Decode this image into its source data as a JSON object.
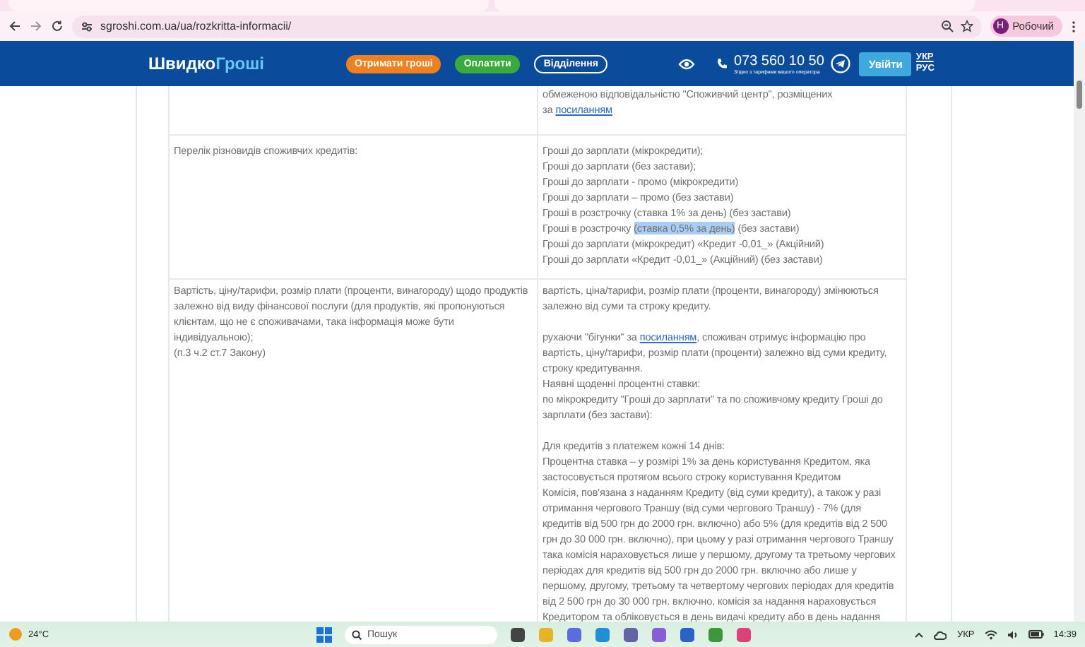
{
  "browser": {
    "url": "sgroshi.com.ua/ua/rozkritta-informacii/",
    "profile_initial": "Н",
    "profile_name": "Робочий"
  },
  "header": {
    "logo": {
      "part_1": "Швидко",
      "part_2": "Гроші"
    },
    "buttons": [
      {
        "label": "Отримати гроші",
        "kind": "orange"
      },
      {
        "label": "Оплатити",
        "kind": "green"
      },
      {
        "label": "Відділення",
        "kind": "outline"
      }
    ],
    "phone": "073 560 10 50",
    "phone_note": "Згідно з тарифами вашого оператора",
    "login": "Увійти",
    "languages": [
      {
        "label": "УКР",
        "selected": true
      },
      {
        "label": "РУС",
        "selected": false
      }
    ]
  },
  "table": {
    "rows": [
      {
        "label": [],
        "content": [
          {
            "kind": "text",
            "text": "обмеженою відповідальністю \"Споживчий центр\", розміщених"
          },
          {
            "kind": "link_text",
            "before": "за ",
            "link": "посиланням"
          }
        ]
      },
      {
        "label": [
          "Перелік різновидів споживчих кредитів:"
        ],
        "content": [
          {
            "kind": "list",
            "items": [
              {
                "segments": [
                  {
                    "text": "Гроші до зарплати (мікрокредити);",
                    "selected": false
                  }
                ]
              },
              {
                "segments": [
                  {
                    "text": "Гроші до зарплати (без застави);",
                    "selected": false
                  }
                ]
              },
              {
                "segments": [
                  {
                    "text": "Гроші до зарплати - промо (мікрокредити)",
                    "selected": false
                  }
                ]
              },
              {
                "segments": [
                  {
                    "text": "Гроші до зарплати – промо (без застави)",
                    "selected": false
                  }
                ]
              },
              {
                "segments": [
                  {
                    "text": "Гроші в розстрочку (ставка 1% за день) (без застави)",
                    "selected": false
                  }
                ]
              },
              {
                "segments": [
                  {
                    "text": "Гроші в розстрочку ",
                    "selected": false
                  },
                  {
                    "text": "(ставка 0,5% за день)",
                    "selected": true
                  },
                  {
                    "text": " (без застави)",
                    "selected": false
                  }
                ]
              },
              {
                "segments": [
                  {
                    "text": "Гроші до зарплати (мікрокредит) «Кредит -0,01_» (Акційний)",
                    "selected": false
                  }
                ]
              },
              {
                "segments": [
                  {
                    "text": "Гроші до зарплати «Кредит -0,01_» (Акційний) (без застави)",
                    "selected": false
                  }
                ]
              }
            ]
          }
        ]
      },
      {
        "label": [
          "Вартість, ціну/тарифи, розмір плати (проценти, винагороду) щодо продуктів залежно від виду фінансової послуги (для продуктів, які пропонуються клієнтам, що не є споживачами, така інформація може бути індивідуальною);",
          "(п.3 ч.2 ст.7 Закону)"
        ],
        "content": [
          {
            "kind": "text",
            "text": "вартість, ціна/тарифи, розмір плати (проценти, винагороду) змінюються залежно від суми та строку кредиту."
          },
          {
            "kind": "gap"
          },
          {
            "kind": "link_text",
            "before": "рухаючи \"бігунки\" за ",
            "link": "посиланням",
            "after": ", споживач отримує інформацію про вартість, ціну/тарифи, розмір плати (проценти) залежно від суми кредиту, строку кредитування."
          },
          {
            "kind": "text",
            "text": "Наявні щоденні процентні ставки:"
          },
          {
            "kind": "text",
            "text": "по мікрокредиту \"Гроші до зарплати\" та по споживчому кредиту Гроші до зарплати (без застави):"
          },
          {
            "kind": "gap"
          },
          {
            "kind": "text",
            "text": "Для кредитів з платежем кожні 14 днів:"
          },
          {
            "kind": "text",
            "text": "Процентна ставка – у розмірі 1% за день користування Кредитом, яка застосовується протягом всього строку користування Кредитом"
          },
          {
            "kind": "text",
            "text": "Комісія, пов'язана з наданням Кредиту (від суми кредиту), а також у разі отримання чергового Траншу (від суми чергового Траншу) - 7% (для кредитів від 500 грн до 2000 грн. включно) або 5% (для кредитів від 2 500 грн до 30 000 грн. включно), при цьому у разі отримання чергового Траншу така комісія нараховується лише у першому, другому та третьому чергових періодах для кредитів від 500 грн до 2000 грн. включно або лише у першому, другому, третьому та четвертому чергових періодах для кредитів від 2 500 грн до 30 000 грн. включно, комісія за надання нараховується Кредитором та обліковується в день видачі кредиту або в день надання"
          }
        ]
      }
    ]
  },
  "taskbar": {
    "temperature": "24°C",
    "search_placeholder": "Пошук",
    "language": "УКР",
    "time": "14:39"
  }
}
